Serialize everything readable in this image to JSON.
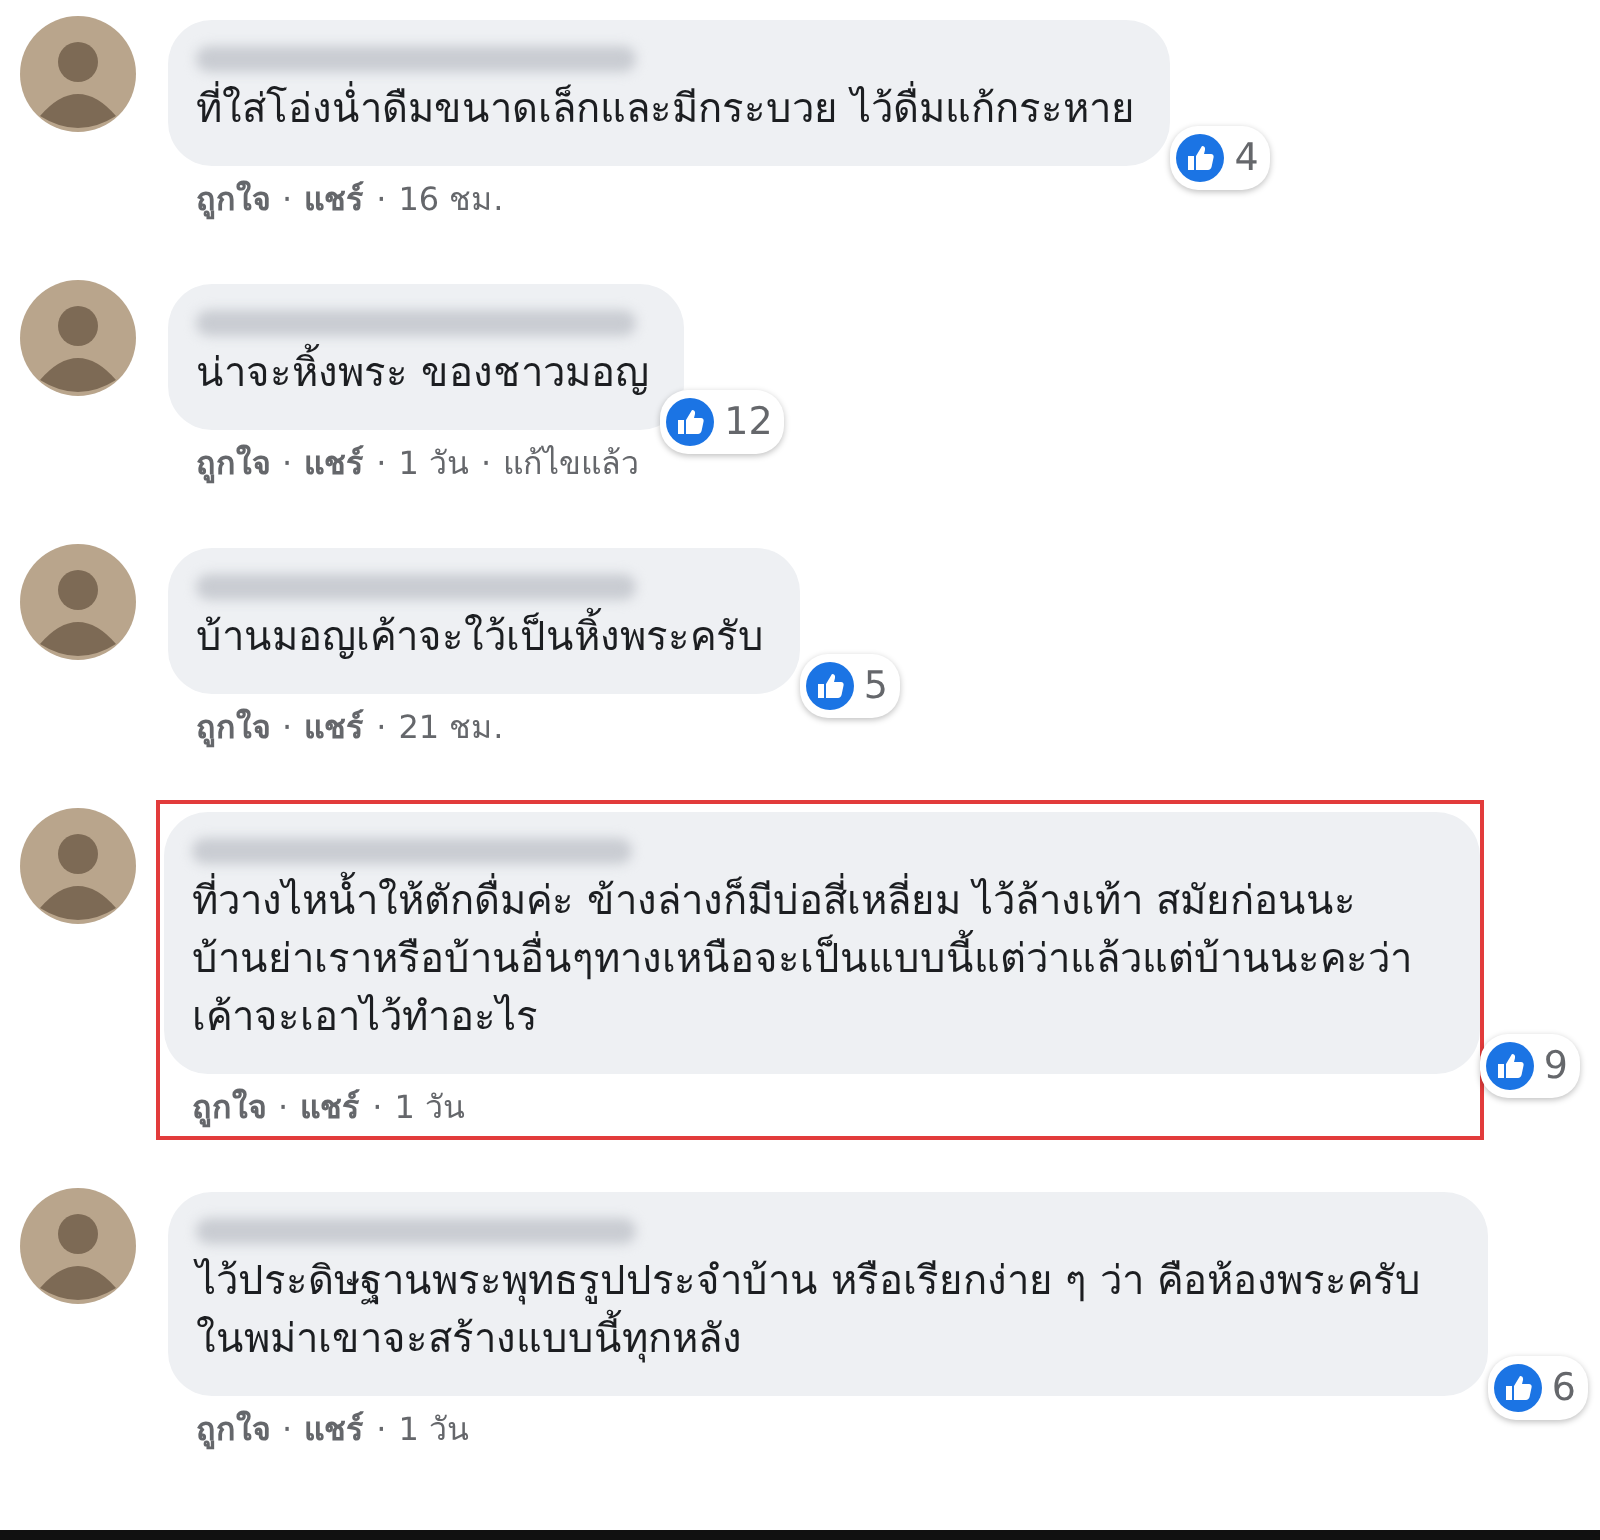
{
  "comments": [
    {
      "text": "ที่ใส่โอ่งน่ำดืมขนาดเล็กและมีกระบวย ไว้ดื่มแก้กระหาย",
      "reactions": "4",
      "actions": [
        "ถูกใจ",
        "แชร์"
      ],
      "time": "16 ชม.",
      "highlighted": false
    },
    {
      "text": "น่าจะหิ้งพระ ของชาวมอญ",
      "reactions": "12",
      "actions": [
        "ถูกใจ",
        "แชร์"
      ],
      "time": "1 วัน",
      "edited": "แก้ไขแล้ว",
      "highlighted": false
    },
    {
      "text": "บ้านมอญเค้าจะใว้เป็นหิ้งพระครับ",
      "reactions": "5",
      "actions": [
        "ถูกใจ",
        "แชร์"
      ],
      "time": "21 ชม.",
      "highlighted": false
    },
    {
      "text": "ที่วางไหน้ำให้ตักดื่มค่ะ ข้างล่างก็มีบ่อสี่เหลี่ยม ไว้ล้างเท้า สมัยก่อนนะ บ้านย่าเราหรือบ้านอื่นๆทางเหนือจะเป็นแบบนี้แต่ว่าแล้วแต่บ้านนะคะว่าเค้าจะเอาไว้ทำอะไร",
      "reactions": "9",
      "actions": [
        "ถูกใจ",
        "แชร์"
      ],
      "time": "1 วัน",
      "highlighted": true
    },
    {
      "text": "ไว้ประดิษฐานพระพุทธรูปประจำบ้าน หรือเรียกง่าย ๆ ว่า คือห้องพระครับ ในพม่าเขาจะสร้างแบบนี้ทุกหลัง",
      "reactions": "6",
      "actions": [
        "ถูกใจ",
        "แชร์"
      ],
      "time": "1 วัน",
      "highlighted": false
    }
  ],
  "separator": "·"
}
